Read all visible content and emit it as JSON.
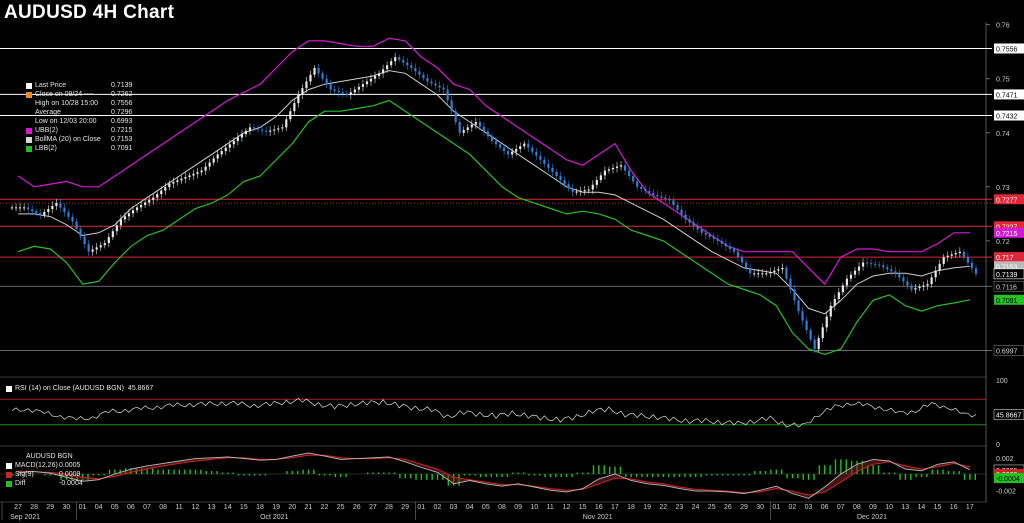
{
  "title": "AUDUSD 4H Chart",
  "colors": {
    "price_up": "#e8e8e8",
    "price_down": "#2f7fd6",
    "ubb": "#d41ad4",
    "lbb": "#25c025",
    "ma": "#cfcfcf",
    "ref_red": "#e0283a",
    "ref_white": "#ffffff",
    "rsi": "#e0e0e0",
    "macd": "#ffffff",
    "sig": "#d02424",
    "diff": "#1fc21f"
  },
  "legend_main": [
    {
      "name": "Last Price",
      "value": "0.7139",
      "color": "#ffffff"
    },
    {
      "name": "Close on 09/24 ----",
      "value": "0.7262",
      "color": "#f08a24"
    },
    {
      "name": "High on 10/28 15:00",
      "value": "0.7556",
      "color": ""
    },
    {
      "name": "Average",
      "value": "0.7296",
      "color": ""
    },
    {
      "name": "Low on 12/03 20:00",
      "value": "0.6993",
      "color": ""
    },
    {
      "name": "UBB(2)",
      "value": "0.7215",
      "color": "#d41ad4"
    },
    {
      "name": "BollMA (20)  on Close",
      "value": "0.7153",
      "color": "#d8d8d8"
    },
    {
      "name": "LBB(2)",
      "value": "0.7091",
      "color": "#25c025"
    }
  ],
  "rsi_legend": {
    "name": "RSI (14)  on Close (AUDUSD BGN)",
    "value": "45.8667"
  },
  "macd_legend": {
    "header": "AUDUSD BGN",
    "rows": [
      {
        "name": "MACD(12,26)",
        "value": "0.0005",
        "color": "#ffffff"
      },
      {
        "name": "Sig(9)",
        "value": "0.0009",
        "color": "#d02424"
      },
      {
        "name": "Diff",
        "value": "-0.0004",
        "color": "#1fc21f"
      }
    ]
  },
  "chart_data": [
    {
      "type": "line",
      "title": "AUDUSD 4H Chart",
      "ylim": [
        0.695,
        0.7605
      ],
      "y_ticks": [
        "0.76",
        "0.75",
        "0.74",
        "0.73",
        "0.72"
      ],
      "x_ticks": [
        "27",
        "28",
        "29",
        "30",
        "01",
        "04",
        "05",
        "06",
        "07",
        "08",
        "11",
        "12",
        "13",
        "14",
        "15",
        "18",
        "19",
        "20",
        "21",
        "22",
        "25",
        "26",
        "27",
        "28",
        "29",
        "01",
        "02",
        "03",
        "04",
        "05",
        "08",
        "09",
        "10",
        "11",
        "12",
        "15",
        "16",
        "17",
        "18",
        "19",
        "22",
        "23",
        "24",
        "25",
        "26",
        "29",
        "30",
        "01",
        "02",
        "03",
        "06",
        "07",
        "08",
        "09",
        "10",
        "13",
        "14",
        "15",
        "16",
        "17"
      ],
      "month_labels": [
        "Sep 2021",
        "Oct 2021",
        "Nov 2021",
        "Dec 2021"
      ],
      "horizontal_lines": [
        {
          "value": 0.7556,
          "label": "0.7556",
          "style": "white"
        },
        {
          "value": 0.7471,
          "label": "0.7471",
          "style": "white"
        },
        {
          "value": 0.7432,
          "label": "0.7432",
          "style": "white"
        },
        {
          "value": 0.7277,
          "label": "0.7277",
          "style": "red"
        },
        {
          "value": 0.7227,
          "label": "0.7227",
          "style": "red"
        },
        {
          "value": 0.717,
          "label": "0.717",
          "style": "red"
        },
        {
          "value": 0.7116,
          "label": "0.7116",
          "style": "gray"
        },
        {
          "value": 0.6997,
          "label": "0.6997",
          "style": "gray"
        }
      ],
      "axis_tags": [
        {
          "value": 0.7215,
          "label": "0.7215",
          "color": "#d41ad4"
        },
        {
          "value": 0.7153,
          "label": "0.7153",
          "color": "#bbbbbb"
        },
        {
          "value": 0.7139,
          "label": "0.7139",
          "color": "#ffffff"
        },
        {
          "value": 0.7091,
          "label": "0.7091",
          "color": "#25c025"
        }
      ],
      "price_close": [
        0.7262,
        0.7248,
        0.727,
        0.7236,
        0.718,
        0.7196,
        0.724,
        0.7262,
        0.728,
        0.7306,
        0.7318,
        0.733,
        0.736,
        0.7385,
        0.741,
        0.7402,
        0.741,
        0.747,
        0.752,
        0.748,
        0.747,
        0.749,
        0.751,
        0.754,
        0.752,
        0.7495,
        0.748,
        0.74,
        0.742,
        0.7385,
        0.736,
        0.738,
        0.735,
        0.732,
        0.729,
        0.7295,
        0.733,
        0.734,
        0.73,
        0.7285,
        0.7275,
        0.724,
        0.7215,
        0.72,
        0.718,
        0.714,
        0.714,
        0.715,
        0.707,
        0.7,
        0.708,
        0.713,
        0.716,
        0.7155,
        0.714,
        0.711,
        0.712,
        0.717,
        0.718,
        0.7139
      ],
      "ubb": [
        0.732,
        0.73,
        0.7305,
        0.731,
        0.73,
        0.73,
        0.732,
        0.734,
        0.736,
        0.738,
        0.74,
        0.742,
        0.744,
        0.746,
        0.7475,
        0.749,
        0.752,
        0.755,
        0.757,
        0.757,
        0.7565,
        0.756,
        0.756,
        0.7575,
        0.757,
        0.754,
        0.752,
        0.749,
        0.748,
        0.745,
        0.743,
        0.741,
        0.739,
        0.737,
        0.735,
        0.734,
        0.736,
        0.738,
        0.733,
        0.729,
        0.727,
        0.725,
        0.723,
        0.721,
        0.719,
        0.718,
        0.718,
        0.718,
        0.718,
        0.715,
        0.712,
        0.717,
        0.7185,
        0.7185,
        0.718,
        0.718,
        0.718,
        0.7195,
        0.7215,
        0.7215
      ],
      "bollma": [
        0.725,
        0.725,
        0.7245,
        0.723,
        0.721,
        0.7215,
        0.723,
        0.726,
        0.728,
        0.73,
        0.732,
        0.734,
        0.736,
        0.738,
        0.74,
        0.741,
        0.743,
        0.746,
        0.748,
        0.749,
        0.7495,
        0.75,
        0.7505,
        0.7515,
        0.751,
        0.749,
        0.747,
        0.744,
        0.742,
        0.74,
        0.738,
        0.736,
        0.734,
        0.732,
        0.73,
        0.729,
        0.729,
        0.7285,
        0.727,
        0.7255,
        0.724,
        0.722,
        0.72,
        0.718,
        0.7165,
        0.715,
        0.7145,
        0.714,
        0.711,
        0.7075,
        0.7065,
        0.709,
        0.712,
        0.7135,
        0.714,
        0.714,
        0.7135,
        0.7145,
        0.715,
        0.7153
      ],
      "lbb": [
        0.718,
        0.719,
        0.7185,
        0.716,
        0.712,
        0.7125,
        0.716,
        0.719,
        0.721,
        0.722,
        0.724,
        0.726,
        0.727,
        0.7285,
        0.731,
        0.732,
        0.735,
        0.738,
        0.742,
        0.744,
        0.744,
        0.7445,
        0.745,
        0.746,
        0.744,
        0.742,
        0.74,
        0.738,
        0.736,
        0.733,
        0.73,
        0.728,
        0.727,
        0.726,
        0.725,
        0.7255,
        0.725,
        0.724,
        0.722,
        0.721,
        0.72,
        0.718,
        0.716,
        0.714,
        0.712,
        0.711,
        0.71,
        0.708,
        0.703,
        0.7,
        0.699,
        0.7,
        0.705,
        0.709,
        0.71,
        0.708,
        0.707,
        0.708,
        0.7085,
        0.7091
      ]
    },
    {
      "type": "line",
      "title": "RSI (14)  on Close (AUDUSD BGN)",
      "ylim": [
        0,
        100
      ],
      "y_ticks": [
        "100",
        "50",
        "0"
      ],
      "levels": [
        70,
        30
      ],
      "values": [
        52,
        55,
        48,
        44,
        38,
        42,
        50,
        53,
        55,
        58,
        60,
        62,
        62,
        64,
        63,
        60,
        62,
        66,
        68,
        62,
        58,
        62,
        64,
        66,
        60,
        56,
        54,
        42,
        50,
        46,
        44,
        48,
        44,
        40,
        38,
        42,
        52,
        54,
        46,
        44,
        42,
        38,
        36,
        36,
        34,
        32,
        36,
        40,
        30,
        28,
        46,
        58,
        64,
        60,
        56,
        48,
        52,
        62,
        58,
        45.8667
      ],
      "current": "45.8667"
    },
    {
      "type": "line",
      "title": "AUDUSD BGN",
      "ylim": [
        -0.0032,
        0.0032
      ],
      "y_ticks": [
        "0.002",
        "-0.002"
      ],
      "macd": [
        0.0002,
        0.0003,
        0.0001,
        -0.0004,
        -0.0009,
        -0.0007,
        0.0,
        0.0006,
        0.001,
        0.0013,
        0.0016,
        0.0019,
        0.002,
        0.0021,
        0.0019,
        0.0017,
        0.0018,
        0.0022,
        0.0026,
        0.0022,
        0.0018,
        0.0019,
        0.002,
        0.0021,
        0.0015,
        0.0008,
        0.0002,
        -0.0012,
        -0.0008,
        -0.0012,
        -0.0015,
        -0.0012,
        -0.0016,
        -0.002,
        -0.0022,
        -0.0018,
        -0.0006,
        0.0,
        -0.0008,
        -0.0012,
        -0.0014,
        -0.0018,
        -0.0021,
        -0.0021,
        -0.0022,
        -0.0024,
        -0.002,
        -0.0015,
        -0.0024,
        -0.003,
        -0.0016,
        0.0,
        0.0012,
        0.0018,
        0.0016,
        0.0006,
        0.0004,
        0.0012,
        0.0015,
        0.0005
      ],
      "sig": [
        0.0003,
        0.0003,
        0.0002,
        0.0,
        -0.0004,
        -0.0006,
        -0.0003,
        0.0002,
        0.0006,
        0.001,
        0.0013,
        0.0016,
        0.0018,
        0.002,
        0.002,
        0.0018,
        0.0018,
        0.002,
        0.0023,
        0.0023,
        0.002,
        0.0019,
        0.0019,
        0.002,
        0.0018,
        0.0012,
        0.0006,
        -0.0004,
        -0.0007,
        -0.001,
        -0.0013,
        -0.0013,
        -0.0015,
        -0.0018,
        -0.002,
        -0.0019,
        -0.0012,
        -0.0005,
        -0.0006,
        -0.001,
        -0.0012,
        -0.0016,
        -0.0019,
        -0.002,
        -0.0021,
        -0.0023,
        -0.0022,
        -0.0018,
        -0.0021,
        -0.0026,
        -0.0022,
        -0.001,
        0.0003,
        0.0012,
        0.0015,
        0.001,
        0.0006,
        0.0009,
        0.0013,
        0.0009
      ],
      "current": {
        "macd": "0.0005",
        "sig": "0.0009",
        "diff": "-0.0004"
      }
    }
  ]
}
